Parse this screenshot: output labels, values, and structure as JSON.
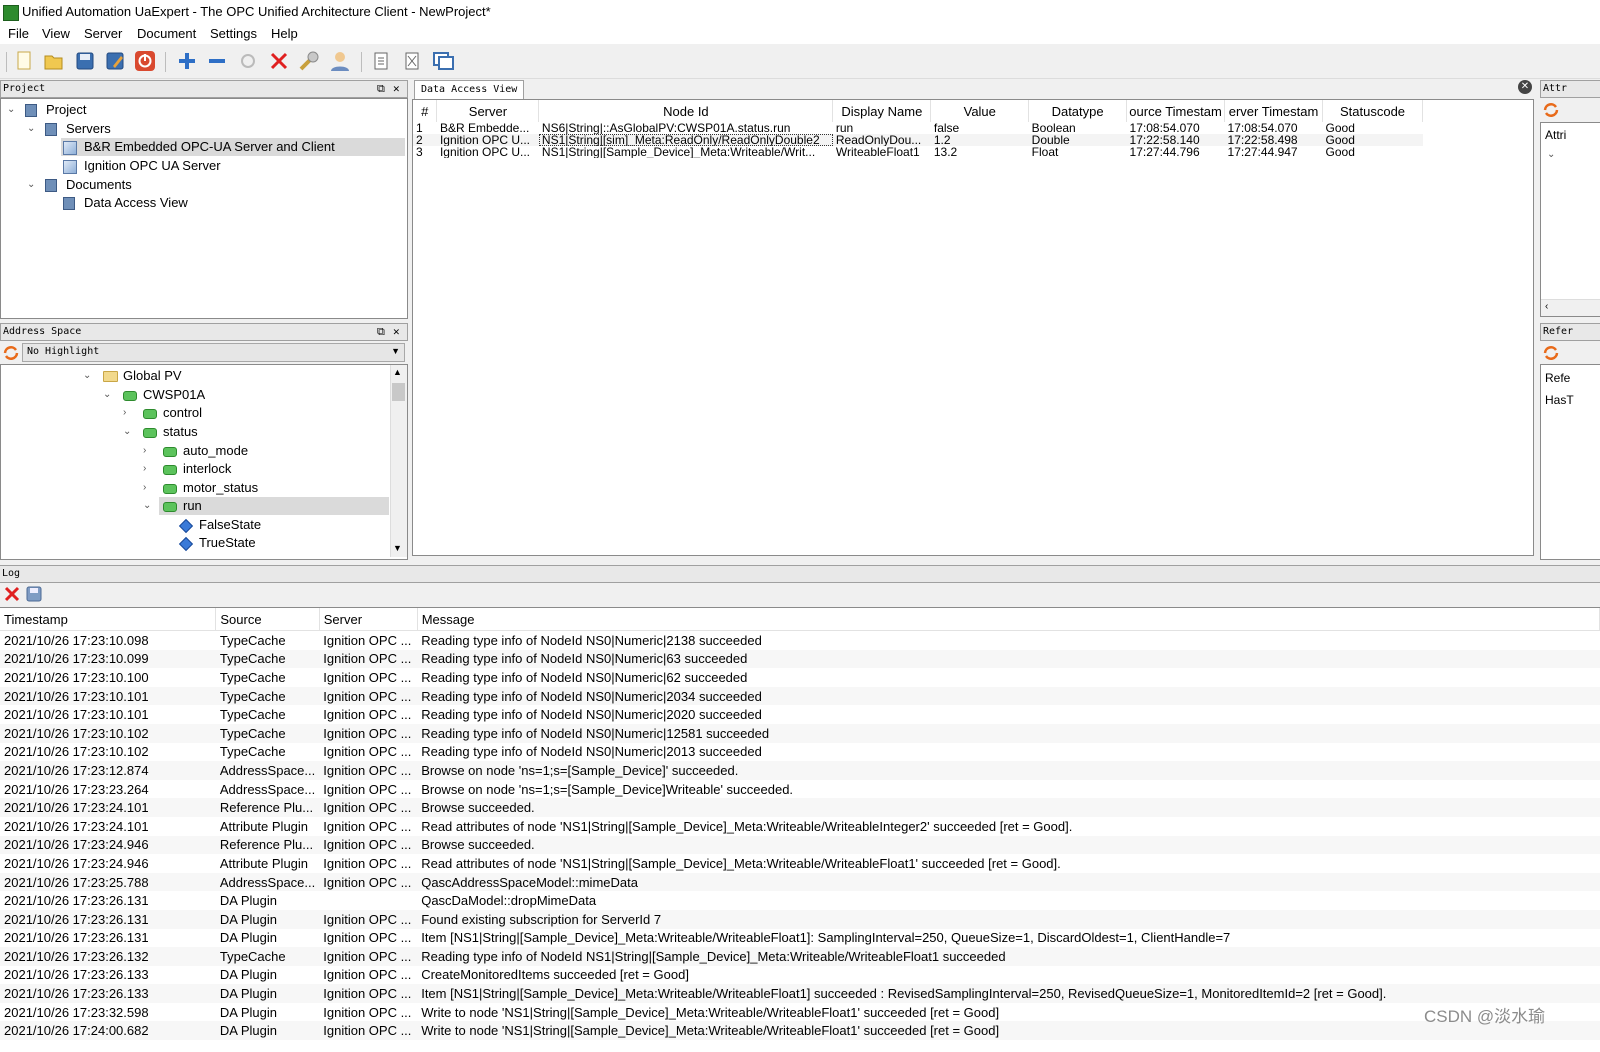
{
  "window": {
    "title": "Unified Automation UaExpert - The OPC Unified Architecture Client - NewProject*"
  },
  "menu": [
    "File",
    "View",
    "Server",
    "Document",
    "Settings",
    "Help"
  ],
  "toolbar": {
    "icons": [
      "new-project-icon",
      "open-project-icon",
      "save-project-icon",
      "save-as-icon",
      "exit-icon",
      "add-server-icon",
      "remove-server-icon",
      "connect-icon",
      "disconnect-icon",
      "settings-wrench-icon",
      "user-icon",
      "document-icon",
      "close-document-icon",
      "window-icon"
    ]
  },
  "project": {
    "header": "Project",
    "root": "Project",
    "servers_label": "Servers",
    "servers": [
      "B&R Embedded OPC-UA Server and Client",
      "Ignition OPC UA Server"
    ],
    "documents_label": "Documents",
    "documents": [
      "Data Access View"
    ]
  },
  "address_space": {
    "header": "Address Space",
    "highlight": "No Highlight",
    "nodes": [
      "Global PV",
      "CWSP01A",
      "control",
      "status",
      "auto_mode",
      "interlock",
      "motor_status",
      "run",
      "FalseState",
      "TrueState"
    ]
  },
  "data_access": {
    "tab": "Data Access View",
    "columns": [
      "#",
      "Server",
      "Node Id",
      "Display Name",
      "Value",
      "Datatype",
      "ource Timestam",
      "erver Timestam",
      "Statuscode"
    ],
    "rows": [
      [
        "1",
        "B&R Embedde...",
        "NS6|String|::AsGlobalPV:CWSP01A.status.run",
        "run",
        "false",
        "Boolean",
        "17:08:54.070",
        "17:08:54.070",
        "Good"
      ],
      [
        "2",
        "Ignition OPC U...",
        "NS1|String|[sim]_Meta:ReadOnly/ReadOnlyDouble2",
        "ReadOnlyDou...",
        "1.2",
        "Double",
        "17:22:58.140",
        "17:22:58.498",
        "Good"
      ],
      [
        "3",
        "Ignition OPC U...",
        "NS1|String|[Sample_Device]_Meta:Writeable/Writ...",
        "WriteableFloat1",
        "13.2",
        "Float",
        "17:27:44.796",
        "17:27:44.947",
        "Good"
      ]
    ]
  },
  "attributes": {
    "header": "Attr",
    "tab": "Attri"
  },
  "references": {
    "header": "Refer",
    "col": "Refe",
    "row": "HasT"
  },
  "log": {
    "header": "Log",
    "columns": [
      "Timestamp",
      "Source",
      "Server",
      "Message"
    ],
    "rows": [
      [
        "2021/10/26 17:23:10.098",
        "TypeCache",
        "Ignition OPC ...",
        "Reading type info of NodeId NS0|Numeric|2138 succeeded"
      ],
      [
        "2021/10/26 17:23:10.099",
        "TypeCache",
        "Ignition OPC ...",
        "Reading type info of NodeId NS0|Numeric|63 succeeded"
      ],
      [
        "2021/10/26 17:23:10.100",
        "TypeCache",
        "Ignition OPC ...",
        "Reading type info of NodeId NS0|Numeric|62 succeeded"
      ],
      [
        "2021/10/26 17:23:10.101",
        "TypeCache",
        "Ignition OPC ...",
        "Reading type info of NodeId NS0|Numeric|2034 succeeded"
      ],
      [
        "2021/10/26 17:23:10.101",
        "TypeCache",
        "Ignition OPC ...",
        "Reading type info of NodeId NS0|Numeric|2020 succeeded"
      ],
      [
        "2021/10/26 17:23:10.102",
        "TypeCache",
        "Ignition OPC ...",
        "Reading type info of NodeId NS0|Numeric|12581 succeeded"
      ],
      [
        "2021/10/26 17:23:10.102",
        "TypeCache",
        "Ignition OPC ...",
        "Reading type info of NodeId NS0|Numeric|2013 succeeded"
      ],
      [
        "2021/10/26 17:23:12.874",
        "AddressSpace...",
        "Ignition OPC ...",
        "Browse on node 'ns=1;s=[Sample_Device]' succeeded."
      ],
      [
        "2021/10/26 17:23:23.264",
        "AddressSpace...",
        "Ignition OPC ...",
        "Browse on node 'ns=1;s=[Sample_Device]Writeable' succeeded."
      ],
      [
        "2021/10/26 17:23:24.101",
        "Reference Plu...",
        "Ignition OPC ...",
        "Browse succeeded."
      ],
      [
        "2021/10/26 17:23:24.101",
        "Attribute Plugin",
        "Ignition OPC ...",
        "Read attributes of node 'NS1|String|[Sample_Device]_Meta:Writeable/WriteableInteger2' succeeded [ret = Good]."
      ],
      [
        "2021/10/26 17:23:24.946",
        "Reference Plu...",
        "Ignition OPC ...",
        "Browse succeeded."
      ],
      [
        "2021/10/26 17:23:24.946",
        "Attribute Plugin",
        "Ignition OPC ...",
        "Read attributes of node 'NS1|String|[Sample_Device]_Meta:Writeable/WriteableFloat1' succeeded [ret = Good]."
      ],
      [
        "2021/10/26 17:23:25.788",
        "AddressSpace...",
        "Ignition OPC ...",
        "QascAddressSpaceModel::mimeData"
      ],
      [
        "2021/10/26 17:23:26.131",
        "DA Plugin",
        "",
        "QascDaModel::dropMimeData"
      ],
      [
        "2021/10/26 17:23:26.131",
        "DA Plugin",
        "Ignition OPC ...",
        "Found existing subscription for ServerId 7"
      ],
      [
        "2021/10/26 17:23:26.131",
        "DA Plugin",
        "Ignition OPC ...",
        "Item [NS1|String|[Sample_Device]_Meta:Writeable/WriteableFloat1]: SamplingInterval=250, QueueSize=1, DiscardOldest=1, ClientHandle=7"
      ],
      [
        "2021/10/26 17:23:26.132",
        "TypeCache",
        "Ignition OPC ...",
        "Reading type info of NodeId NS1|String|[Sample_Device]_Meta:Writeable/WriteableFloat1 succeeded"
      ],
      [
        "2021/10/26 17:23:26.133",
        "DA Plugin",
        "Ignition OPC ...",
        "CreateMonitoredItems succeeded [ret = Good]"
      ],
      [
        "2021/10/26 17:23:26.133",
        "DA Plugin",
        "Ignition OPC ...",
        "Item [NS1|String|[Sample_Device]_Meta:Writeable/WriteableFloat1] succeeded : RevisedSamplingInterval=250, RevisedQueueSize=1, MonitoredItemId=2 [ret = Good]."
      ],
      [
        "2021/10/26 17:23:32.598",
        "DA Plugin",
        "Ignition OPC ...",
        "Write to node 'NS1|String|[Sample_Device]_Meta:Writeable/WriteableFloat1' succeeded [ret = Good]"
      ],
      [
        "2021/10/26 17:24:00.682",
        "DA Plugin",
        "Ignition OPC ...",
        "Write to node 'NS1|String|[Sample_Device]_Meta:Writeable/WriteableFloat1' succeeded [ret = Good]"
      ]
    ]
  },
  "watermark": "CSDN @淡水瑜"
}
